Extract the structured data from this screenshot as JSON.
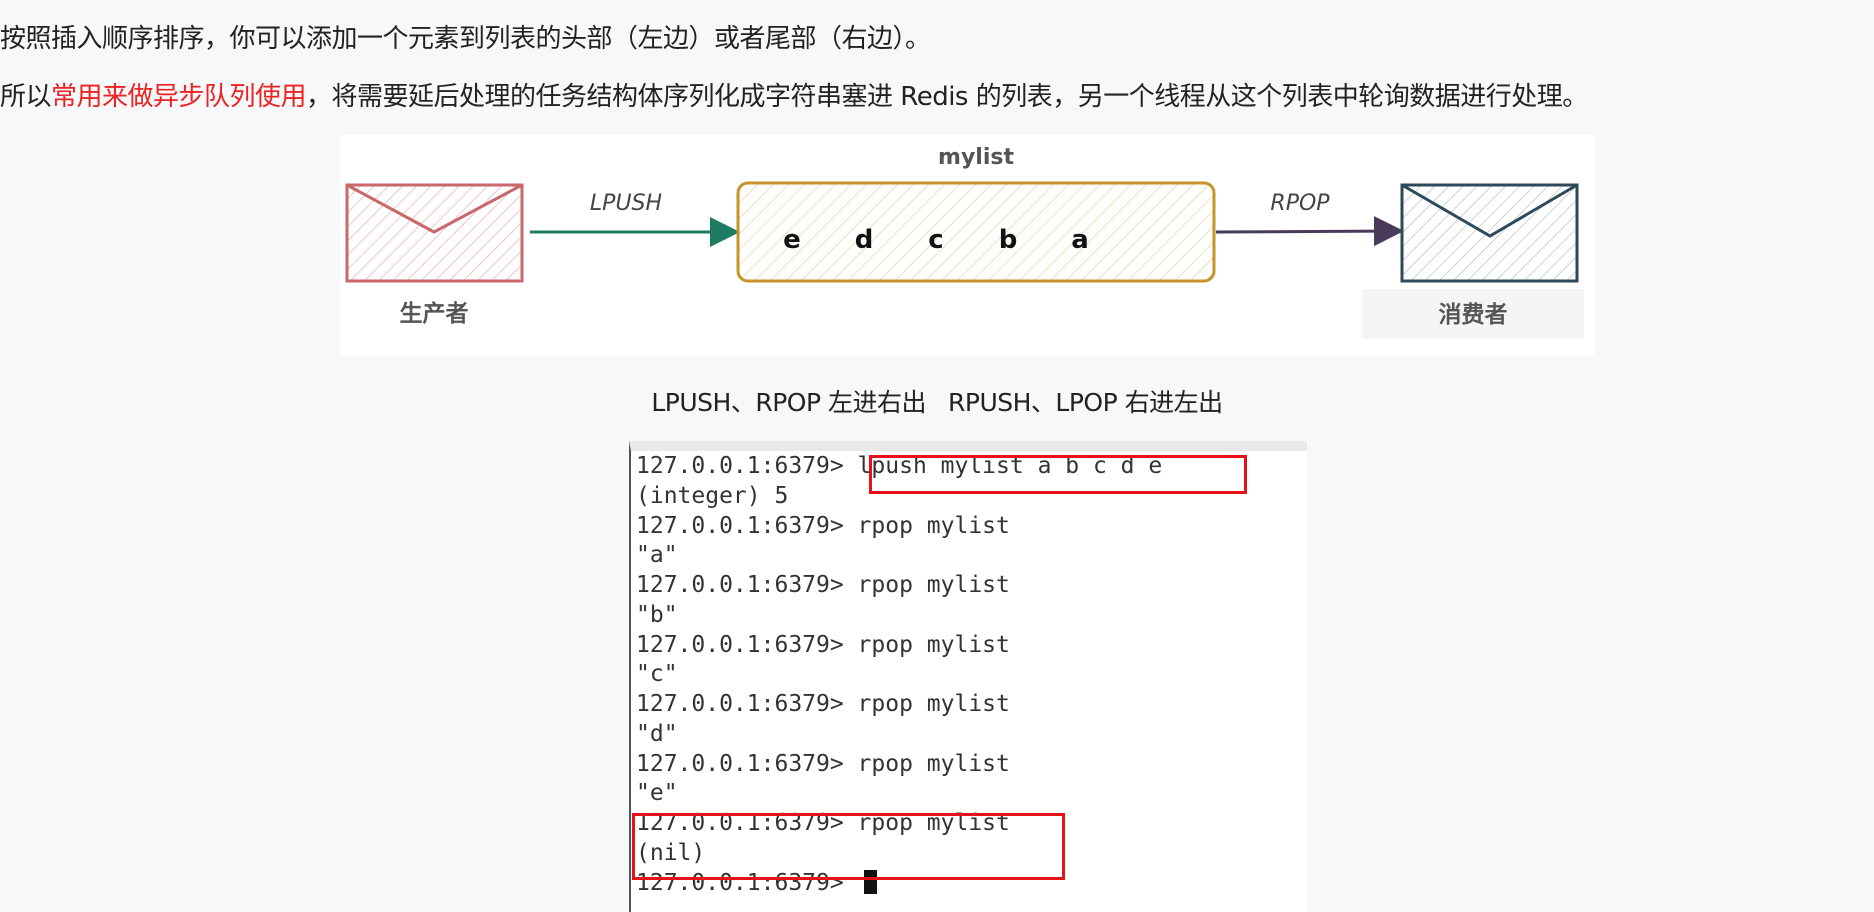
{
  "paragraphs": {
    "p1": "按照插入顺序排序，你可以添加一个元素到列表的头部（左边）或者尾部（右边）。",
    "p2_prefix": "所以",
    "p2_highlight": "常用来做异步队列使用",
    "p2_suffix": "，将需要延后处理的任务结构体序列化成字符串塞进 Redis 的列表，另一个线程从这个列表中轮询数据进行处理。"
  },
  "diagram": {
    "list_name": "mylist",
    "push_label": "LPUSH",
    "pop_label": "RPOP",
    "producer_label": "生产者",
    "consumer_label": "消费者",
    "elements": [
      "e",
      "d",
      "c",
      "b",
      "a"
    ],
    "colors": {
      "producer": "#c9676a",
      "list": "#c8942a",
      "consumer": "#2e4a5a",
      "push_arrow": "#1f7a62",
      "pop_arrow": "#4a3a5a"
    }
  },
  "caption": {
    "left": "LPUSH、RPOP 左进右出",
    "right": "RPUSH、LPOP 右进左出"
  },
  "terminal": {
    "lines": [
      "127.0.0.1:6379> lpush mylist a b c d e",
      "(integer) 5",
      "127.0.0.1:6379> rpop mylist",
      "\"a\"",
      "127.0.0.1:6379> rpop mylist",
      "\"b\"",
      "127.0.0.1:6379> rpop mylist",
      "\"c\"",
      "127.0.0.1:6379> rpop mylist",
      "\"d\"",
      "127.0.0.1:6379> rpop mylist",
      "\"e\"",
      "127.0.0.1:6379> rpop mylist",
      "(nil)"
    ],
    "prompt": "127.0.0.1:6379> "
  },
  "highlight_color": "#e8101a"
}
